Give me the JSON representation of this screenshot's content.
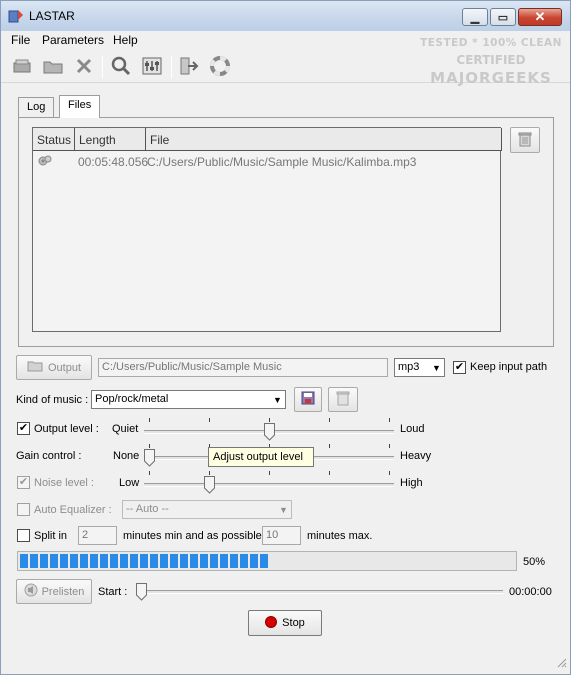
{
  "window": {
    "title": "LASTAR"
  },
  "menu": [
    "File",
    "Parameters",
    "Help"
  ],
  "watermark": {
    "line1": "TESTED * 100% CLEAN",
    "line2": "CERTIFIED",
    "line3": "MAJORGEEKS"
  },
  "tabs": [
    {
      "label": "Log",
      "active": false
    },
    {
      "label": "Files",
      "active": true
    }
  ],
  "filelist": {
    "columns": [
      "Status",
      "Length",
      "File"
    ],
    "rows": [
      {
        "length": "00:05:48.056",
        "file": "C:/Users/Public/Music/Sample Music/Kalimba.mp3"
      }
    ]
  },
  "output": {
    "button_label": "Output",
    "path": "C:/Users/Public/Music/Sample Music",
    "format": "mp3",
    "keep_input_path_label": "Keep input path",
    "keep_input_path": true
  },
  "kind_of_music": {
    "label": "Kind of music :",
    "value": "Pop/rock/metal"
  },
  "output_level": {
    "label": "Output level :",
    "checked": true,
    "min_label": "Quiet",
    "max_label": "Loud",
    "level": 0.5
  },
  "gain_control": {
    "label": "Gain control :",
    "min_label": "None",
    "max_label": "Heavy",
    "level": 0.0
  },
  "noise_level": {
    "label": "Noise level :",
    "checked": true,
    "min_label": "Low",
    "max_label": "High",
    "level": 0.25
  },
  "tooltip": "Adjust output level",
  "auto_equalizer": {
    "label": "Auto Equalizer :",
    "value": "-- Auto --"
  },
  "split": {
    "label": "Split in",
    "min_value": "2",
    "middle_label": "minutes min and as possible",
    "max_value": "10",
    "max_label": "minutes max."
  },
  "progress": {
    "percent": 50,
    "text": "50%"
  },
  "prelisten": {
    "button_label": "Prelisten",
    "start_label": "Start :",
    "time": "00:00:00",
    "position": 0.0
  },
  "stop_button": "Stop",
  "colors": {
    "accent": "#2b8ae6",
    "stop": "#d60000"
  }
}
